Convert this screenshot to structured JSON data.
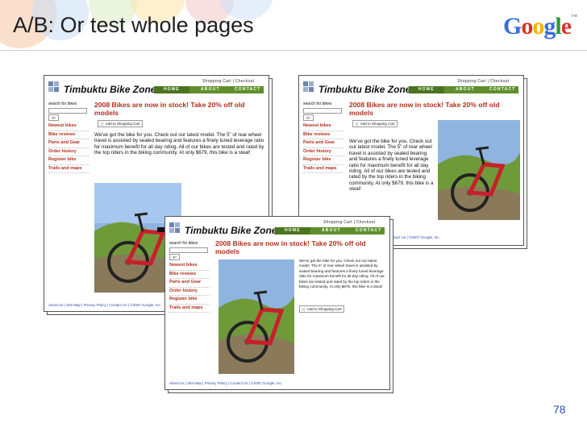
{
  "slide": {
    "title": "A/B: Or test whole pages",
    "logo": "Google",
    "logo_letters": [
      "G",
      "o",
      "o",
      "g",
      "l",
      "e"
    ],
    "logo_colors": [
      "#3a6fd8",
      "#d8352a",
      "#f0b400",
      "#3a6fd8",
      "#2a9a3a",
      "#d8352a"
    ],
    "page_number": "78"
  },
  "site": {
    "title": "Timbuktu Bike Zone",
    "top_links": {
      "cart": "Shopping Cart",
      "sep": "|",
      "checkout": "Checkout"
    },
    "tabs": {
      "home": "HOME",
      "about": "ABOUT",
      "contact": "CONTACT"
    },
    "search_label": "search for bikes",
    "go": "go",
    "nav": [
      "Newest bikes",
      "Bike reviews",
      "Parts and Gear",
      "Order history",
      "Register bike",
      "Trails and maps"
    ],
    "headline": "2008 Bikes are now in stock! Take 20% off old models",
    "cart_button": "Add to Shopping Cart",
    "body": "We've got the bike for you. Check out our latest model. The 5\" of rear wheel travel is assisted by sealed bearing and features a finely tuned leverage ratio for maximum benefit for all day riding. All of our bikes are tested and rated by the top riders in the biking community. At only $679, this bike is a steal!",
    "footer": {
      "about": "About Us",
      "sitemap": "Site Map",
      "privacy": "Privacy Policy",
      "contact": "Contact Us",
      "copyright": "©2007 Google, Inc."
    }
  },
  "colors": {
    "accent_green": "#5f8f2c",
    "link_red": "#b0301c",
    "footer_blue": "#2a4db0"
  }
}
